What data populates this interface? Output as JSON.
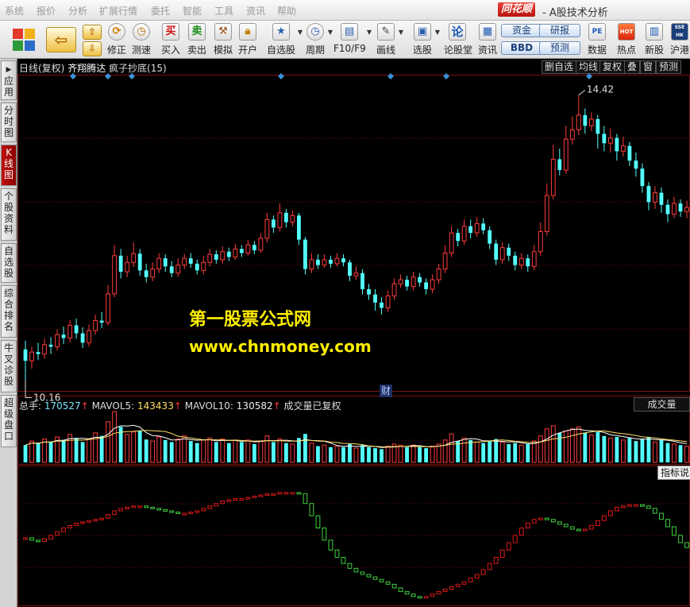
{
  "menu": {
    "items": [
      "系统",
      "报价",
      "分析",
      "扩展行情",
      "委托",
      "智能",
      "工具",
      "资讯",
      "帮助"
    ],
    "brand": "同花顺",
    "app_title": "- A股技术分析"
  },
  "toolbar": {
    "correct": "修正",
    "speed": "测速",
    "buy": "买入",
    "sell": "卖出",
    "simulate": "模拟",
    "open": "开户",
    "watchlist": "自选股",
    "period": "周期",
    "f10": "F10/F9",
    "draw": "画线",
    "pick": "选股",
    "forum": "论股堂",
    "news": "资讯",
    "fund": "资金",
    "research": "研报",
    "bbd": "BBD",
    "forecast": "预测",
    "data": "数据",
    "hot": "热点",
    "newstock": "新股",
    "hk": "沪港",
    "buy_icon": "买",
    "sell_icon": "卖",
    "forum_icon": "论",
    "pe_icon": "PE",
    "hot_icon": "HOT",
    "hk_icon": "SSE HK"
  },
  "sidebar": [
    "应用",
    "分时图",
    "K线图",
    "个股资料",
    "自选股",
    "综合排名",
    "牛叉诊股",
    "超级盘口"
  ],
  "kline": {
    "title_period": "日线(复权)",
    "stock_name": "齐翔腾达",
    "indicator": "疯子抄底(15)",
    "right_tabs": [
      "删自选",
      "均线",
      "复权",
      "叠",
      "窗",
      "预测"
    ],
    "high_label": "14.42",
    "low_label": "10.16",
    "finance_marker": "财"
  },
  "watermark": {
    "line1": "第一股票公式网",
    "line2": "www.chnmoney.com"
  },
  "volume": {
    "label_total": "总手:",
    "total": "170527",
    "label_ma5": "MAVOL5:",
    "ma5": "143433",
    "label_ma10": "MAVOL10:",
    "ma10": "130582",
    "arrow": "↑",
    "note": "成交量已复权",
    "tab": "成交量"
  },
  "indicator_panel": {
    "tab": "指标说明"
  },
  "colors": {
    "up": "#ff3c3c",
    "down": "#54ffff",
    "ind_up": "#e01818",
    "ind_down": "#3fd43f",
    "marker": "#3a8fd8",
    "grid": "#7a1010"
  },
  "chart_data": {
    "type": "candlestick",
    "price_range": [
      10.0,
      14.7
    ],
    "high_price": 14.42,
    "low_price": 10.16,
    "candles": [
      [
        10.62,
        10.45,
        10.75,
        10.16
      ],
      [
        10.45,
        10.58,
        10.66,
        10.33
      ],
      [
        10.58,
        10.55,
        10.72,
        10.46
      ],
      [
        10.55,
        10.69,
        10.78,
        10.48
      ],
      [
        10.69,
        10.66,
        10.8,
        10.55
      ],
      [
        10.66,
        10.84,
        10.92,
        10.6
      ],
      [
        10.84,
        10.79,
        10.96,
        10.7
      ],
      [
        10.79,
        10.98,
        11.06,
        10.72
      ],
      [
        10.98,
        10.86,
        11.08,
        10.78
      ],
      [
        10.86,
        10.72,
        10.95,
        10.64
      ],
      [
        10.72,
        10.9,
        10.99,
        10.66
      ],
      [
        10.9,
        11.05,
        11.14,
        10.84
      ],
      [
        11.05,
        11.02,
        11.18,
        10.94
      ],
      [
        11.02,
        11.45,
        11.58,
        10.98
      ],
      [
        11.45,
        12.02,
        12.18,
        11.4
      ],
      [
        12.02,
        11.78,
        12.12,
        11.68
      ],
      [
        11.78,
        11.92,
        12.02,
        11.7
      ],
      [
        11.92,
        12.05,
        12.22,
        11.85
      ],
      [
        12.05,
        11.8,
        12.12,
        11.72
      ],
      [
        11.8,
        11.7,
        11.9,
        11.62
      ],
      [
        11.7,
        11.82,
        11.92,
        11.64
      ],
      [
        11.82,
        11.98,
        12.06,
        11.76
      ],
      [
        11.98,
        11.86,
        12.04,
        11.78
      ],
      [
        11.86,
        11.76,
        11.94,
        11.7
      ],
      [
        11.76,
        11.88,
        11.98,
        11.7
      ],
      [
        11.88,
        11.98,
        12.05,
        11.82
      ],
      [
        11.98,
        11.9,
        12.06,
        11.84
      ],
      [
        11.9,
        11.8,
        11.96,
        11.74
      ],
      [
        11.8,
        11.92,
        12.02,
        11.74
      ],
      [
        11.92,
        12.04,
        12.12,
        11.86
      ],
      [
        12.04,
        11.96,
        12.1,
        11.9
      ],
      [
        11.96,
        12.08,
        12.16,
        11.9
      ],
      [
        12.08,
        12.0,
        12.14,
        11.94
      ],
      [
        12.0,
        12.12,
        12.2,
        11.96
      ],
      [
        12.12,
        12.06,
        12.18,
        12.0
      ],
      [
        12.06,
        12.18,
        12.26,
        12.02
      ],
      [
        12.18,
        12.1,
        12.24,
        12.04
      ],
      [
        12.1,
        12.28,
        12.36,
        12.06
      ],
      [
        12.28,
        12.56,
        12.66,
        12.22
      ],
      [
        12.56,
        12.44,
        12.62,
        12.36
      ],
      [
        12.44,
        12.66,
        12.8,
        12.38
      ],
      [
        12.66,
        12.52,
        12.72,
        12.44
      ],
      [
        12.52,
        12.62,
        12.7,
        12.46
      ],
      [
        12.62,
        12.26,
        12.66,
        12.18
      ],
      [
        12.26,
        11.82,
        12.3,
        11.74
      ],
      [
        11.82,
        11.96,
        12.06,
        11.76
      ],
      [
        11.96,
        11.88,
        12.04,
        11.82
      ],
      [
        11.88,
        11.96,
        12.04,
        11.84
      ],
      [
        11.96,
        11.9,
        12.02,
        11.84
      ],
      [
        11.9,
        11.98,
        12.06,
        11.86
      ],
      [
        11.98,
        11.92,
        12.04,
        11.86
      ],
      [
        11.92,
        11.72,
        11.96,
        11.64
      ],
      [
        11.72,
        11.76,
        11.86,
        11.66
      ],
      [
        11.76,
        11.52,
        11.82,
        11.44
      ],
      [
        11.52,
        11.44,
        11.6,
        11.36
      ],
      [
        11.44,
        11.32,
        11.52,
        11.2
      ],
      [
        11.32,
        11.24,
        11.4,
        11.14
      ],
      [
        11.24,
        11.42,
        11.5,
        11.18
      ],
      [
        11.42,
        11.6,
        11.68,
        11.36
      ],
      [
        11.6,
        11.66,
        11.74,
        11.54
      ],
      [
        11.66,
        11.56,
        11.72,
        11.5
      ],
      [
        11.56,
        11.7,
        11.78,
        11.5
      ],
      [
        11.7,
        11.62,
        11.76,
        11.56
      ],
      [
        11.62,
        11.52,
        11.68,
        11.44
      ],
      [
        11.52,
        11.66,
        11.74,
        11.46
      ],
      [
        11.66,
        11.82,
        11.9,
        11.6
      ],
      [
        11.82,
        12.06,
        12.18,
        11.76
      ],
      [
        12.06,
        12.36,
        12.46,
        12.0
      ],
      [
        12.36,
        12.24,
        12.42,
        12.16
      ],
      [
        12.24,
        12.46,
        12.56,
        12.18
      ],
      [
        12.46,
        12.36,
        12.56,
        12.28
      ],
      [
        12.36,
        12.5,
        12.6,
        12.3
      ],
      [
        12.5,
        12.4,
        12.58,
        12.34
      ],
      [
        12.4,
        12.2,
        12.46,
        12.12
      ],
      [
        12.2,
        11.96,
        12.26,
        11.88
      ],
      [
        11.96,
        12.14,
        12.22,
        11.9
      ],
      [
        12.14,
        12.02,
        12.2,
        11.94
      ],
      [
        12.02,
        11.88,
        12.08,
        11.8
      ],
      [
        11.88,
        11.98,
        12.06,
        11.82
      ],
      [
        11.98,
        11.86,
        12.04,
        11.78
      ],
      [
        11.86,
        12.08,
        12.18,
        11.8
      ],
      [
        12.08,
        12.38,
        12.52,
        12.02
      ],
      [
        12.38,
        12.92,
        13.1,
        12.32
      ],
      [
        12.92,
        13.46,
        13.68,
        12.86
      ],
      [
        13.46,
        13.3,
        13.62,
        13.22
      ],
      [
        13.3,
        13.76,
        13.96,
        13.24
      ],
      [
        13.76,
        13.9,
        14.1,
        13.68
      ],
      [
        13.9,
        14.12,
        14.42,
        13.82
      ],
      [
        14.12,
        13.96,
        14.22,
        13.84
      ],
      [
        13.96,
        14.06,
        14.16,
        13.88
      ],
      [
        14.06,
        13.84,
        14.12,
        13.62
      ],
      [
        13.84,
        13.7,
        13.96,
        13.58
      ],
      [
        13.7,
        13.78,
        13.92,
        13.56
      ],
      [
        13.78,
        13.58,
        13.84,
        13.44
      ],
      [
        13.58,
        13.66,
        13.8,
        13.5
      ],
      [
        13.66,
        13.44,
        13.72,
        13.36
      ],
      [
        13.44,
        13.32,
        13.56,
        13.2
      ],
      [
        13.32,
        13.06,
        13.4,
        12.96
      ],
      [
        13.06,
        12.82,
        13.12,
        12.7
      ],
      [
        12.82,
        12.96,
        13.06,
        12.72
      ],
      [
        12.96,
        12.78,
        13.04,
        12.66
      ],
      [
        12.78,
        12.64,
        12.86,
        12.52
      ],
      [
        12.64,
        12.8,
        12.9,
        12.58
      ],
      [
        12.8,
        12.68,
        12.86,
        12.6
      ],
      [
        12.68,
        12.74,
        12.84,
        12.58
      ]
    ],
    "volume": [
      0.34,
      0.42,
      0.38,
      0.46,
      0.4,
      0.5,
      0.44,
      0.55,
      0.48,
      0.4,
      0.46,
      0.58,
      0.52,
      0.8,
      1.0,
      0.7,
      0.55,
      0.6,
      0.62,
      0.45,
      0.42,
      0.5,
      0.44,
      0.4,
      0.46,
      0.52,
      0.42,
      0.38,
      0.44,
      0.48,
      0.4,
      0.46,
      0.38,
      0.44,
      0.4,
      0.44,
      0.36,
      0.42,
      0.52,
      0.4,
      0.46,
      0.38,
      0.36,
      0.48,
      0.56,
      0.38,
      0.32,
      0.34,
      0.3,
      0.32,
      0.3,
      0.36,
      0.28,
      0.34,
      0.3,
      0.28,
      0.26,
      0.32,
      0.36,
      0.34,
      0.3,
      0.34,
      0.3,
      0.28,
      0.32,
      0.36,
      0.44,
      0.56,
      0.42,
      0.48,
      0.44,
      0.4,
      0.38,
      0.42,
      0.46,
      0.4,
      0.36,
      0.38,
      0.34,
      0.36,
      0.42,
      0.52,
      0.66,
      0.72,
      0.58,
      0.62,
      0.66,
      0.7,
      0.58,
      0.54,
      0.6,
      0.52,
      0.48,
      0.5,
      0.44,
      0.48,
      0.42,
      0.46,
      0.5,
      0.4,
      0.44,
      0.38,
      0.36,
      0.34,
      0.32
    ],
    "indicator": [
      0.54,
      0.52,
      0.51,
      0.53,
      0.56,
      0.59,
      0.62,
      0.64,
      0.66,
      0.67,
      0.68,
      0.69,
      0.7,
      0.73,
      0.76,
      0.78,
      0.79,
      0.8,
      0.8,
      0.79,
      0.78,
      0.77,
      0.76,
      0.75,
      0.74,
      0.74,
      0.75,
      0.76,
      0.78,
      0.8,
      0.82,
      0.84,
      0.85,
      0.86,
      0.86,
      0.87,
      0.88,
      0.89,
      0.9,
      0.9,
      0.91,
      0.91,
      0.91,
      0.9,
      0.82,
      0.72,
      0.62,
      0.52,
      0.44,
      0.38,
      0.33,
      0.29,
      0.26,
      0.24,
      0.22,
      0.2,
      0.18,
      0.16,
      0.13,
      0.1,
      0.08,
      0.06,
      0.05,
      0.06,
      0.08,
      0.1,
      0.12,
      0.14,
      0.16,
      0.18,
      0.21,
      0.24,
      0.28,
      0.33,
      0.38,
      0.44,
      0.5,
      0.56,
      0.62,
      0.66,
      0.69,
      0.7,
      0.69,
      0.67,
      0.65,
      0.63,
      0.61,
      0.6,
      0.61,
      0.64,
      0.68,
      0.72,
      0.76,
      0.79,
      0.8,
      0.81,
      0.81,
      0.8,
      0.78,
      0.74,
      0.69,
      0.63,
      0.56,
      0.5,
      0.46
    ]
  }
}
